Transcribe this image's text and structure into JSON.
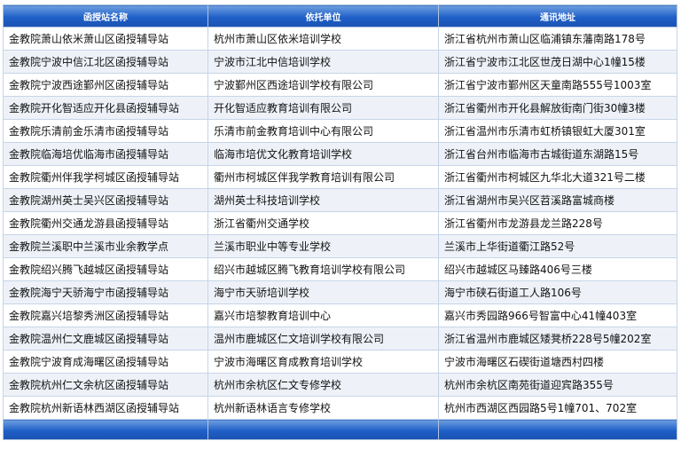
{
  "table": {
    "headers": [
      "函授站名称",
      "依托单位",
      "通讯地址"
    ],
    "rows": [
      [
        "金教院萧山依米萧山区函授辅导站",
        "杭州市萧山区依米培训学校",
        "浙江省杭州市萧山区临浦镇东藩南路178号"
      ],
      [
        "金教院宁波中信江北区函授辅导站",
        "宁波市江北中信培训学校",
        "浙江省宁波市江北区世茂日湖中心1幢15楼"
      ],
      [
        "金教院宁波西途鄞州区函授辅导站",
        "宁波鄞州区西途培训学校有限公司",
        "浙江省宁波市鄞州区天童南路555号1003室"
      ],
      [
        "金教院开化智适应开化县函授辅导站",
        "开化智适应教育培训有限公司",
        "浙江省衢州市开化县解放街南门街30幢3楼"
      ],
      [
        "金教院乐清前金乐清市函授辅导站",
        "乐清市前金教育培训中心有限公司",
        "浙江省温州市乐清市虹桥镇银虹大厦301室"
      ],
      [
        "金教院临海培优临海市函授辅导站",
        "临海市培优文化教育培训学校",
        "浙江省台州市临海市古城街道东湖路15号"
      ],
      [
        "金教院衢州伴我学柯城区函授辅导站",
        "衢州市柯城区伴我学教育培训有限公司",
        "浙江省衢州市柯城区九华北大道321号二楼"
      ],
      [
        "金教院湖州英士吴兴区函授辅导站",
        "湖州英士科技培训学校",
        "浙江省湖州市吴兴区苕溪路富城商楼"
      ],
      [
        "金教院衢州交通龙游县函授辅导站",
        "浙江省衢州交通学校",
        "浙江省衢州市龙游县龙兰路228号"
      ],
      [
        "金教院兰溪职中兰溪市业余教学点",
        "兰溪市职业中等专业学校",
        "兰溪市上华街道衢江路52号"
      ],
      [
        "金教院绍兴腾飞越城区函授辅导站",
        "绍兴市越城区腾飞教育培训学校有限公司",
        "绍兴市越城区马臻路406号三楼"
      ],
      [
        "金教院海宁天骄海宁市函授辅导站",
        "海宁市天骄培训学校",
        "海宁市硖石街道工人路106号"
      ],
      [
        "金教院嘉兴培黎秀洲区函授辅导站",
        "嘉兴市培黎教育培训中心",
        "嘉兴市秀园路966号智富中心41幢403室"
      ],
      [
        "金教院温州仁文鹿城区函授辅导站",
        "温州市鹿城区仁文培训学校有限公司",
        "浙江省温州市鹿城区矮凳桥228号5幢202室"
      ],
      [
        "金教院宁波育成海曙区函授辅导站",
        "宁波市海曙区育成教育培训学校",
        "宁波市海曙区石碶街道塘西村四楼"
      ],
      [
        "金教院杭州仁文余杭区函授辅导站",
        "杭州市余杭区仁文专修学校",
        "杭州市余杭区南苑街道迎宾路355号"
      ],
      [
        "金教院杭州新语林西湖区函授辅导站",
        "杭州新语林语言专修学校",
        "杭州市西湖区西园路5号1幢701、702室"
      ]
    ]
  }
}
